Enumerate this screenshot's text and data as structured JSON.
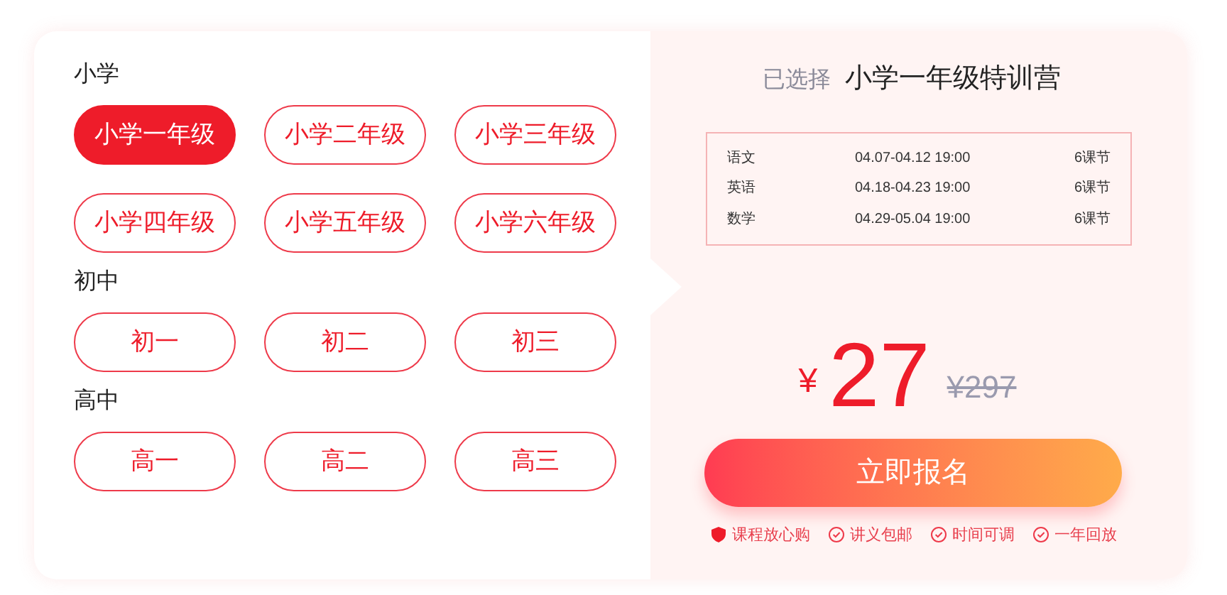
{
  "groups": [
    {
      "title": "小学",
      "grades": [
        {
          "label": "小学一年级",
          "selected": true
        },
        {
          "label": "小学二年级",
          "selected": false
        },
        {
          "label": "小学三年级",
          "selected": false
        },
        {
          "label": "小学四年级",
          "selected": false
        },
        {
          "label": "小学五年级",
          "selected": false
        },
        {
          "label": "小学六年级",
          "selected": false
        }
      ]
    },
    {
      "title": "初中",
      "grades": [
        {
          "label": "初一",
          "selected": false
        },
        {
          "label": "初二",
          "selected": false
        },
        {
          "label": "初三",
          "selected": false
        }
      ]
    },
    {
      "title": "高中",
      "grades": [
        {
          "label": "高一",
          "selected": false
        },
        {
          "label": "高二",
          "selected": false
        },
        {
          "label": "高三",
          "selected": false
        }
      ]
    }
  ],
  "summary": {
    "prefix": "已选择",
    "course": "小学一年级特训营",
    "schedule": [
      {
        "subject": "语文",
        "dates": "04.07-04.12 19:00",
        "lessons": "6课节"
      },
      {
        "subject": "英语",
        "dates": "04.18-04.23 19:00",
        "lessons": "6课节"
      },
      {
        "subject": "数学",
        "dates": "04.29-05.04 19:00",
        "lessons": "6课节"
      }
    ],
    "currency": "¥",
    "price": "27",
    "original_price": "¥297",
    "button": "立即报名",
    "guarantees": [
      {
        "kind": "shield",
        "label": "课程放心购"
      },
      {
        "kind": "check",
        "label": "讲义包邮"
      },
      {
        "kind": "check",
        "label": "时间可调"
      },
      {
        "kind": "check",
        "label": "一年回放"
      }
    ]
  }
}
